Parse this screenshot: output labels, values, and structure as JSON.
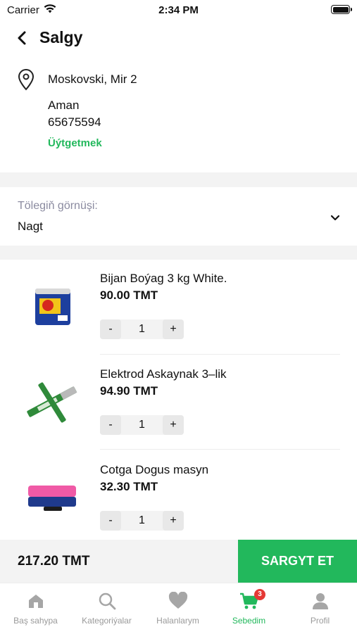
{
  "status_bar": {
    "carrier": "Carrier",
    "time": "2:34 PM"
  },
  "header": {
    "title": "Salgy"
  },
  "address": {
    "line": "Moskovski, Mir 2",
    "name": "Aman",
    "phone": "65675594",
    "edit_label": "Üýtgetmek"
  },
  "payment": {
    "label": "Tölegiň görnüşi:",
    "value": "Nagt"
  },
  "products": [
    {
      "name": "Bijan Boýag 3 kg White.",
      "price": "90.00 TMT",
      "quantity": "1",
      "minus": "-",
      "plus": "+"
    },
    {
      "name": "Elektrod Askaynak 3–lik",
      "price": "94.90 TMT",
      "quantity": "1",
      "minus": "-",
      "plus": "+"
    },
    {
      "name": "Cotga Dogus masyn",
      "price": "32.30 TMT",
      "quantity": "1",
      "minus": "-",
      "plus": "+"
    }
  ],
  "checkout": {
    "total": "217.20 TMT",
    "button_label": "SARGYT ET"
  },
  "tabs": [
    {
      "label": "Baş sahypa",
      "icon": "home-icon",
      "active": false
    },
    {
      "label": "Kategoriýalar",
      "icon": "search-icon",
      "active": false
    },
    {
      "label": "Halanlarym",
      "icon": "heart-icon",
      "active": false
    },
    {
      "label": "Sebedim",
      "icon": "cart-icon",
      "active": true,
      "badge": "3"
    },
    {
      "label": "Profil",
      "icon": "person-icon",
      "active": false
    }
  ],
  "colors": {
    "accent": "#22b85c",
    "badge": "#e53935",
    "muted": "#9a9a9a"
  }
}
